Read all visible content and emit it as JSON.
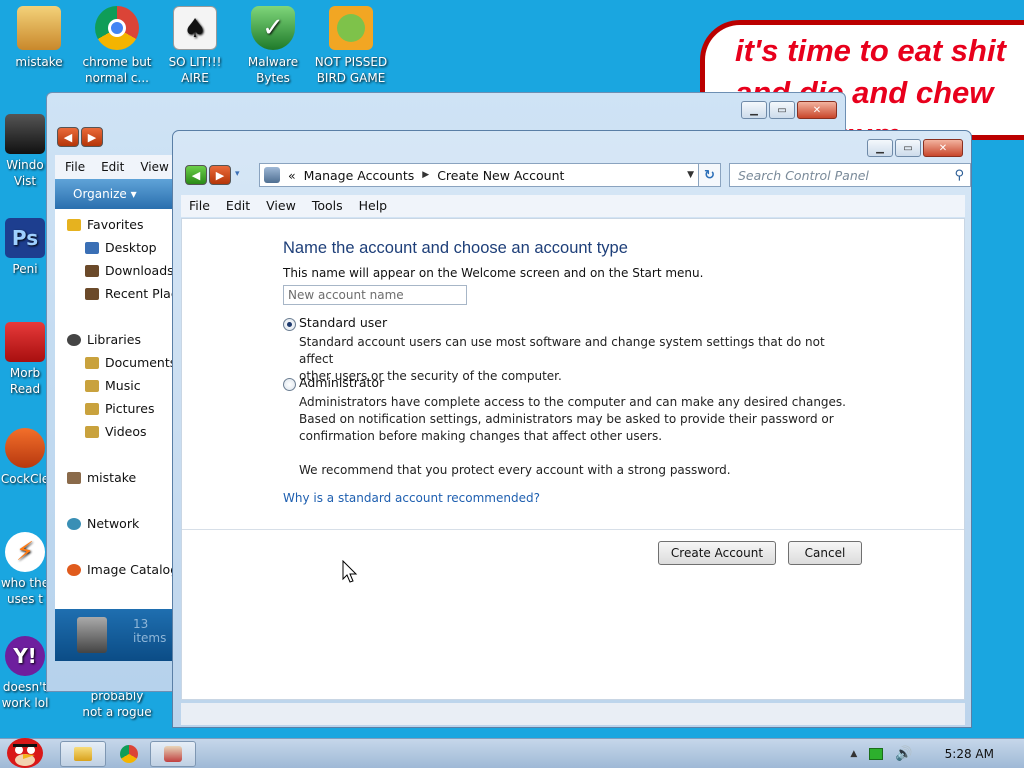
{
  "desktop": {
    "icons_top": [
      {
        "label_1": "mistake",
        "label_2": "",
        "color": "#d89c3a"
      },
      {
        "label_1": "chrome but",
        "label_2": "normal c...",
        "color": "#db4437"
      },
      {
        "label_1": "SO LIT!!!",
        "label_2": "AIRE",
        "color": "#e8e8e8"
      },
      {
        "label_1": "Malware",
        "label_2": "Bytes",
        "color": "#2f8f3a"
      },
      {
        "label_1": "NOT PISSED",
        "label_2": "BIRD GAME",
        "color": "#f2a623"
      }
    ],
    "icons_left": [
      {
        "label_1": "Windo",
        "label_2": "Vist",
        "color": "#1b1b1b"
      },
      {
        "label_1": "Peni",
        "label_2": "",
        "color": "#1d3e8f"
      },
      {
        "label_1": "Morb",
        "label_2": "Read",
        "color": "#c81a1a"
      },
      {
        "label_1": "CockCle",
        "label_2": "",
        "color": "#e05b1d"
      },
      {
        "label_1": "who the",
        "label_2": "uses t",
        "color": "#ff7a12"
      },
      {
        "label_1": "doesn't",
        "label_2": "work lol",
        "color": "#6e1f9e"
      }
    ],
    "icon_probably": {
      "label_1": "probably",
      "label_2": "not a rogue"
    },
    "bubble_lines": [
      "it's time to eat shit",
      "and die and chew",
      "gum"
    ]
  },
  "back_window": {
    "menu": [
      "File",
      "Edit",
      "View"
    ],
    "organize": "Organize ▾",
    "nav_items": [
      {
        "label": "Favorites",
        "color": "#e6b21f"
      },
      {
        "label": "Desktop",
        "color": "#3a6fb5"
      },
      {
        "label": "Downloads",
        "color": "#6b4a2a"
      },
      {
        "label": "Recent Places",
        "color": "#6b4a2a"
      },
      {
        "label": "Libraries",
        "color": "#444444"
      },
      {
        "label": "Documents",
        "color": "#c9a23d"
      },
      {
        "label": "Music",
        "color": "#c9a23d"
      },
      {
        "label": "Pictures",
        "color": "#c9a23d"
      },
      {
        "label": "Videos",
        "color": "#c9a23d"
      },
      {
        "label": "mistake",
        "color": "#8a6a4a"
      },
      {
        "label": "Network",
        "color": "#3a8fb5"
      },
      {
        "label": "Image Catalog",
        "color": "#e05b1d"
      }
    ],
    "status_count": "13 items"
  },
  "dialog": {
    "breadcrumb": [
      "«",
      "Manage Accounts",
      "Create New Account"
    ],
    "search_placeholder": "Search Control Panel",
    "menu": [
      "File",
      "Edit",
      "View",
      "Tools",
      "Help"
    ],
    "title": "Name the account and choose an account type",
    "subtitle": "This name will appear on the Welcome screen and on the Start menu.",
    "name_placeholder": "New account name",
    "standard": {
      "label": "Standard user",
      "selected": true,
      "desc_1": "Standard account users can use most software and change system settings that do not affect",
      "desc_2": "other users or the security of the computer."
    },
    "admin": {
      "label": "Administrator",
      "selected": false,
      "desc_1": "Administrators have complete access to the computer and can make any desired changes.",
      "desc_2": "Based on notification settings, administrators may be asked to provide their password or",
      "desc_3": "confirmation before making changes that affect other users."
    },
    "recommend": "We recommend that you protect every account with a strong password.",
    "link": "Why is a standard account recommended?",
    "create_button": "Create Account",
    "cancel_button": "Cancel"
  },
  "taskbar": {
    "clock": "5:28 AM"
  }
}
